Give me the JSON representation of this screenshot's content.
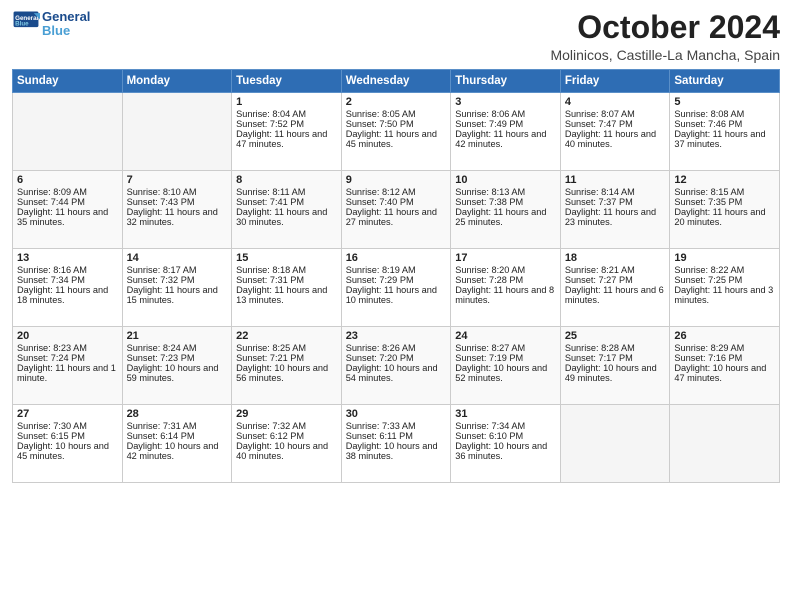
{
  "header": {
    "logo_line1": "General",
    "logo_line2": "Blue",
    "month": "October 2024",
    "location": "Molinicos, Castille-La Mancha, Spain"
  },
  "days_of_week": [
    "Sunday",
    "Monday",
    "Tuesday",
    "Wednesday",
    "Thursday",
    "Friday",
    "Saturday"
  ],
  "weeks": [
    [
      {
        "day": "",
        "data": ""
      },
      {
        "day": "",
        "data": ""
      },
      {
        "day": "1",
        "data": "Sunrise: 8:04 AM\nSunset: 7:52 PM\nDaylight: 11 hours and 47 minutes."
      },
      {
        "day": "2",
        "data": "Sunrise: 8:05 AM\nSunset: 7:50 PM\nDaylight: 11 hours and 45 minutes."
      },
      {
        "day": "3",
        "data": "Sunrise: 8:06 AM\nSunset: 7:49 PM\nDaylight: 11 hours and 42 minutes."
      },
      {
        "day": "4",
        "data": "Sunrise: 8:07 AM\nSunset: 7:47 PM\nDaylight: 11 hours and 40 minutes."
      },
      {
        "day": "5",
        "data": "Sunrise: 8:08 AM\nSunset: 7:46 PM\nDaylight: 11 hours and 37 minutes."
      }
    ],
    [
      {
        "day": "6",
        "data": "Sunrise: 8:09 AM\nSunset: 7:44 PM\nDaylight: 11 hours and 35 minutes."
      },
      {
        "day": "7",
        "data": "Sunrise: 8:10 AM\nSunset: 7:43 PM\nDaylight: 11 hours and 32 minutes."
      },
      {
        "day": "8",
        "data": "Sunrise: 8:11 AM\nSunset: 7:41 PM\nDaylight: 11 hours and 30 minutes."
      },
      {
        "day": "9",
        "data": "Sunrise: 8:12 AM\nSunset: 7:40 PM\nDaylight: 11 hours and 27 minutes."
      },
      {
        "day": "10",
        "data": "Sunrise: 8:13 AM\nSunset: 7:38 PM\nDaylight: 11 hours and 25 minutes."
      },
      {
        "day": "11",
        "data": "Sunrise: 8:14 AM\nSunset: 7:37 PM\nDaylight: 11 hours and 23 minutes."
      },
      {
        "day": "12",
        "data": "Sunrise: 8:15 AM\nSunset: 7:35 PM\nDaylight: 11 hours and 20 minutes."
      }
    ],
    [
      {
        "day": "13",
        "data": "Sunrise: 8:16 AM\nSunset: 7:34 PM\nDaylight: 11 hours and 18 minutes."
      },
      {
        "day": "14",
        "data": "Sunrise: 8:17 AM\nSunset: 7:32 PM\nDaylight: 11 hours and 15 minutes."
      },
      {
        "day": "15",
        "data": "Sunrise: 8:18 AM\nSunset: 7:31 PM\nDaylight: 11 hours and 13 minutes."
      },
      {
        "day": "16",
        "data": "Sunrise: 8:19 AM\nSunset: 7:29 PM\nDaylight: 11 hours and 10 minutes."
      },
      {
        "day": "17",
        "data": "Sunrise: 8:20 AM\nSunset: 7:28 PM\nDaylight: 11 hours and 8 minutes."
      },
      {
        "day": "18",
        "data": "Sunrise: 8:21 AM\nSunset: 7:27 PM\nDaylight: 11 hours and 6 minutes."
      },
      {
        "day": "19",
        "data": "Sunrise: 8:22 AM\nSunset: 7:25 PM\nDaylight: 11 hours and 3 minutes."
      }
    ],
    [
      {
        "day": "20",
        "data": "Sunrise: 8:23 AM\nSunset: 7:24 PM\nDaylight: 11 hours and 1 minute."
      },
      {
        "day": "21",
        "data": "Sunrise: 8:24 AM\nSunset: 7:23 PM\nDaylight: 10 hours and 59 minutes."
      },
      {
        "day": "22",
        "data": "Sunrise: 8:25 AM\nSunset: 7:21 PM\nDaylight: 10 hours and 56 minutes."
      },
      {
        "day": "23",
        "data": "Sunrise: 8:26 AM\nSunset: 7:20 PM\nDaylight: 10 hours and 54 minutes."
      },
      {
        "day": "24",
        "data": "Sunrise: 8:27 AM\nSunset: 7:19 PM\nDaylight: 10 hours and 52 minutes."
      },
      {
        "day": "25",
        "data": "Sunrise: 8:28 AM\nSunset: 7:17 PM\nDaylight: 10 hours and 49 minutes."
      },
      {
        "day": "26",
        "data": "Sunrise: 8:29 AM\nSunset: 7:16 PM\nDaylight: 10 hours and 47 minutes."
      }
    ],
    [
      {
        "day": "27",
        "data": "Sunrise: 7:30 AM\nSunset: 6:15 PM\nDaylight: 10 hours and 45 minutes."
      },
      {
        "day": "28",
        "data": "Sunrise: 7:31 AM\nSunset: 6:14 PM\nDaylight: 10 hours and 42 minutes."
      },
      {
        "day": "29",
        "data": "Sunrise: 7:32 AM\nSunset: 6:12 PM\nDaylight: 10 hours and 40 minutes."
      },
      {
        "day": "30",
        "data": "Sunrise: 7:33 AM\nSunset: 6:11 PM\nDaylight: 10 hours and 38 minutes."
      },
      {
        "day": "31",
        "data": "Sunrise: 7:34 AM\nSunset: 6:10 PM\nDaylight: 10 hours and 36 minutes."
      },
      {
        "day": "",
        "data": ""
      },
      {
        "day": "",
        "data": ""
      }
    ]
  ]
}
